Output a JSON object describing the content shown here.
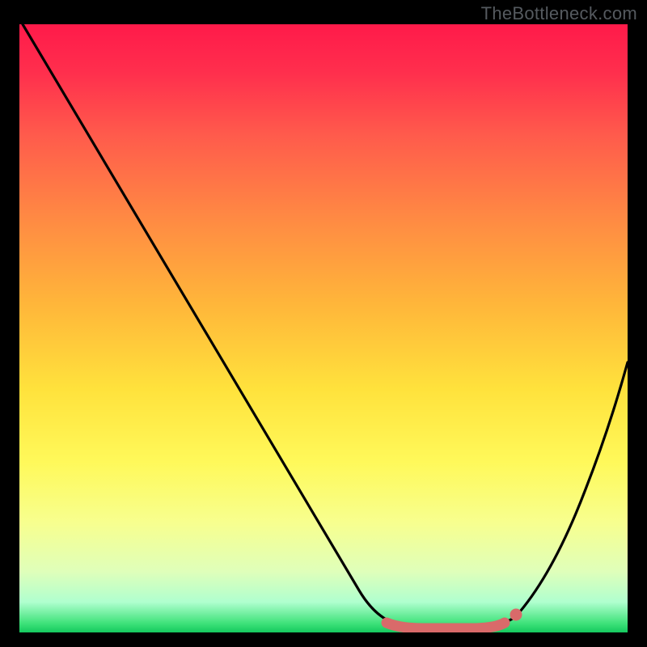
{
  "attribution": "TheBottleneck.com",
  "colors": {
    "page_bg": "#000000",
    "attribution_text": "#555a5f",
    "curve_stroke": "#000000",
    "marker_stroke": "#d96a6a",
    "marker_fill": "#d96a6a",
    "gradient_stops": [
      {
        "pos": 0.0,
        "color": "#ff1a4a"
      },
      {
        "pos": 0.08,
        "color": "#ff2f4d"
      },
      {
        "pos": 0.18,
        "color": "#ff5a4c"
      },
      {
        "pos": 0.32,
        "color": "#ff8a43"
      },
      {
        "pos": 0.46,
        "color": "#ffb63a"
      },
      {
        "pos": 0.6,
        "color": "#ffe23c"
      },
      {
        "pos": 0.72,
        "color": "#fff95a"
      },
      {
        "pos": 0.82,
        "color": "#f7ff8f"
      },
      {
        "pos": 0.9,
        "color": "#dfffba"
      },
      {
        "pos": 0.95,
        "color": "#b0ffcf"
      },
      {
        "pos": 0.985,
        "color": "#3fe27a"
      },
      {
        "pos": 1.0,
        "color": "#14c95e"
      }
    ]
  },
  "chart_data": {
    "type": "line",
    "title": "",
    "xlabel": "",
    "ylabel": "",
    "xlim": [
      0,
      100
    ],
    "ylim": [
      0,
      100
    ],
    "x": [
      0,
      10,
      20,
      30,
      40,
      50,
      56,
      60,
      64,
      68,
      72,
      76,
      80,
      84,
      88,
      92,
      96,
      100
    ],
    "series": [
      {
        "name": "bottleneck-curve",
        "values": [
          100,
          86,
          72,
          57,
          43,
          28,
          13,
          5,
          1,
          0,
          0,
          0,
          1,
          5,
          12,
          22,
          33,
          45
        ]
      }
    ],
    "highlight_range": {
      "x_start": 60,
      "x_end": 80
    },
    "marker": {
      "x": 80,
      "y": 1
    }
  }
}
